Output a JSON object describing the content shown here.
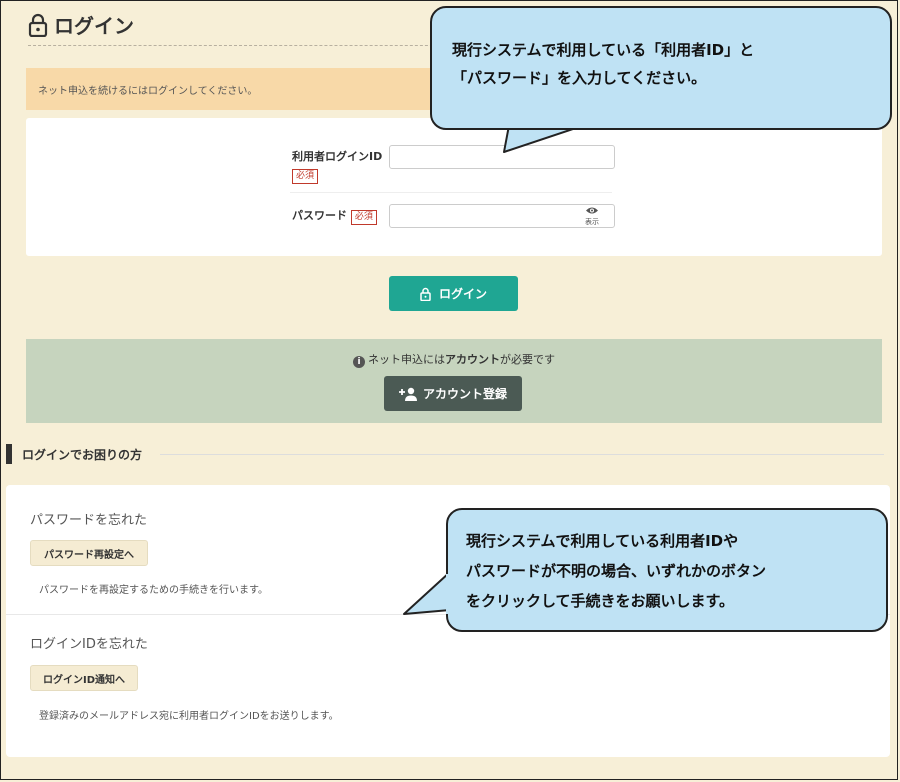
{
  "page": {
    "title": "ログイン"
  },
  "notice": {
    "text": "ネット申込を続けるにはログインしてください。"
  },
  "form": {
    "user_id_label": "利用者ログインID",
    "password_label": "パスワード",
    "required_badge": "必須",
    "user_id_value": "",
    "password_value": "",
    "show_password_label": "表示"
  },
  "login_button": {
    "label": "ログイン"
  },
  "account": {
    "note_prefix": "ネット申込には",
    "note_bold": "アカウント",
    "note_suffix": "が必要です",
    "register_label": "アカウント登録"
  },
  "trouble": {
    "heading": "ログインでお困りの方",
    "forgot_password_title": "パスワードを忘れた",
    "reset_password_button": "パスワード再設定へ",
    "reset_password_desc": "パスワードを再設定するための手続きを行います。",
    "forgot_id_title": "ログインIDを忘れた",
    "notify_id_button": "ログインID通知へ",
    "notify_id_desc": "登録済みのメールアドレス宛に利用者ログインIDをお送りします。"
  },
  "callouts": {
    "top_line1": "現行システムで利用している「利用者ID」と",
    "top_line2": "「パスワード」を入力してください。",
    "bottom_line1": "現行システムで利用している利用者IDや",
    "bottom_line2": "パスワードが不明の場合、いずれかのボタン",
    "bottom_line3": "をクリックして手続きをお願いします。"
  },
  "colors": {
    "background": "#f7efd7",
    "primary": "#1fa693",
    "secondary": "#4b5a54",
    "notice": "#f8d9a8",
    "account_panel": "#c6d4be",
    "callout": "#bfe2f4",
    "required": "#c0392b"
  }
}
